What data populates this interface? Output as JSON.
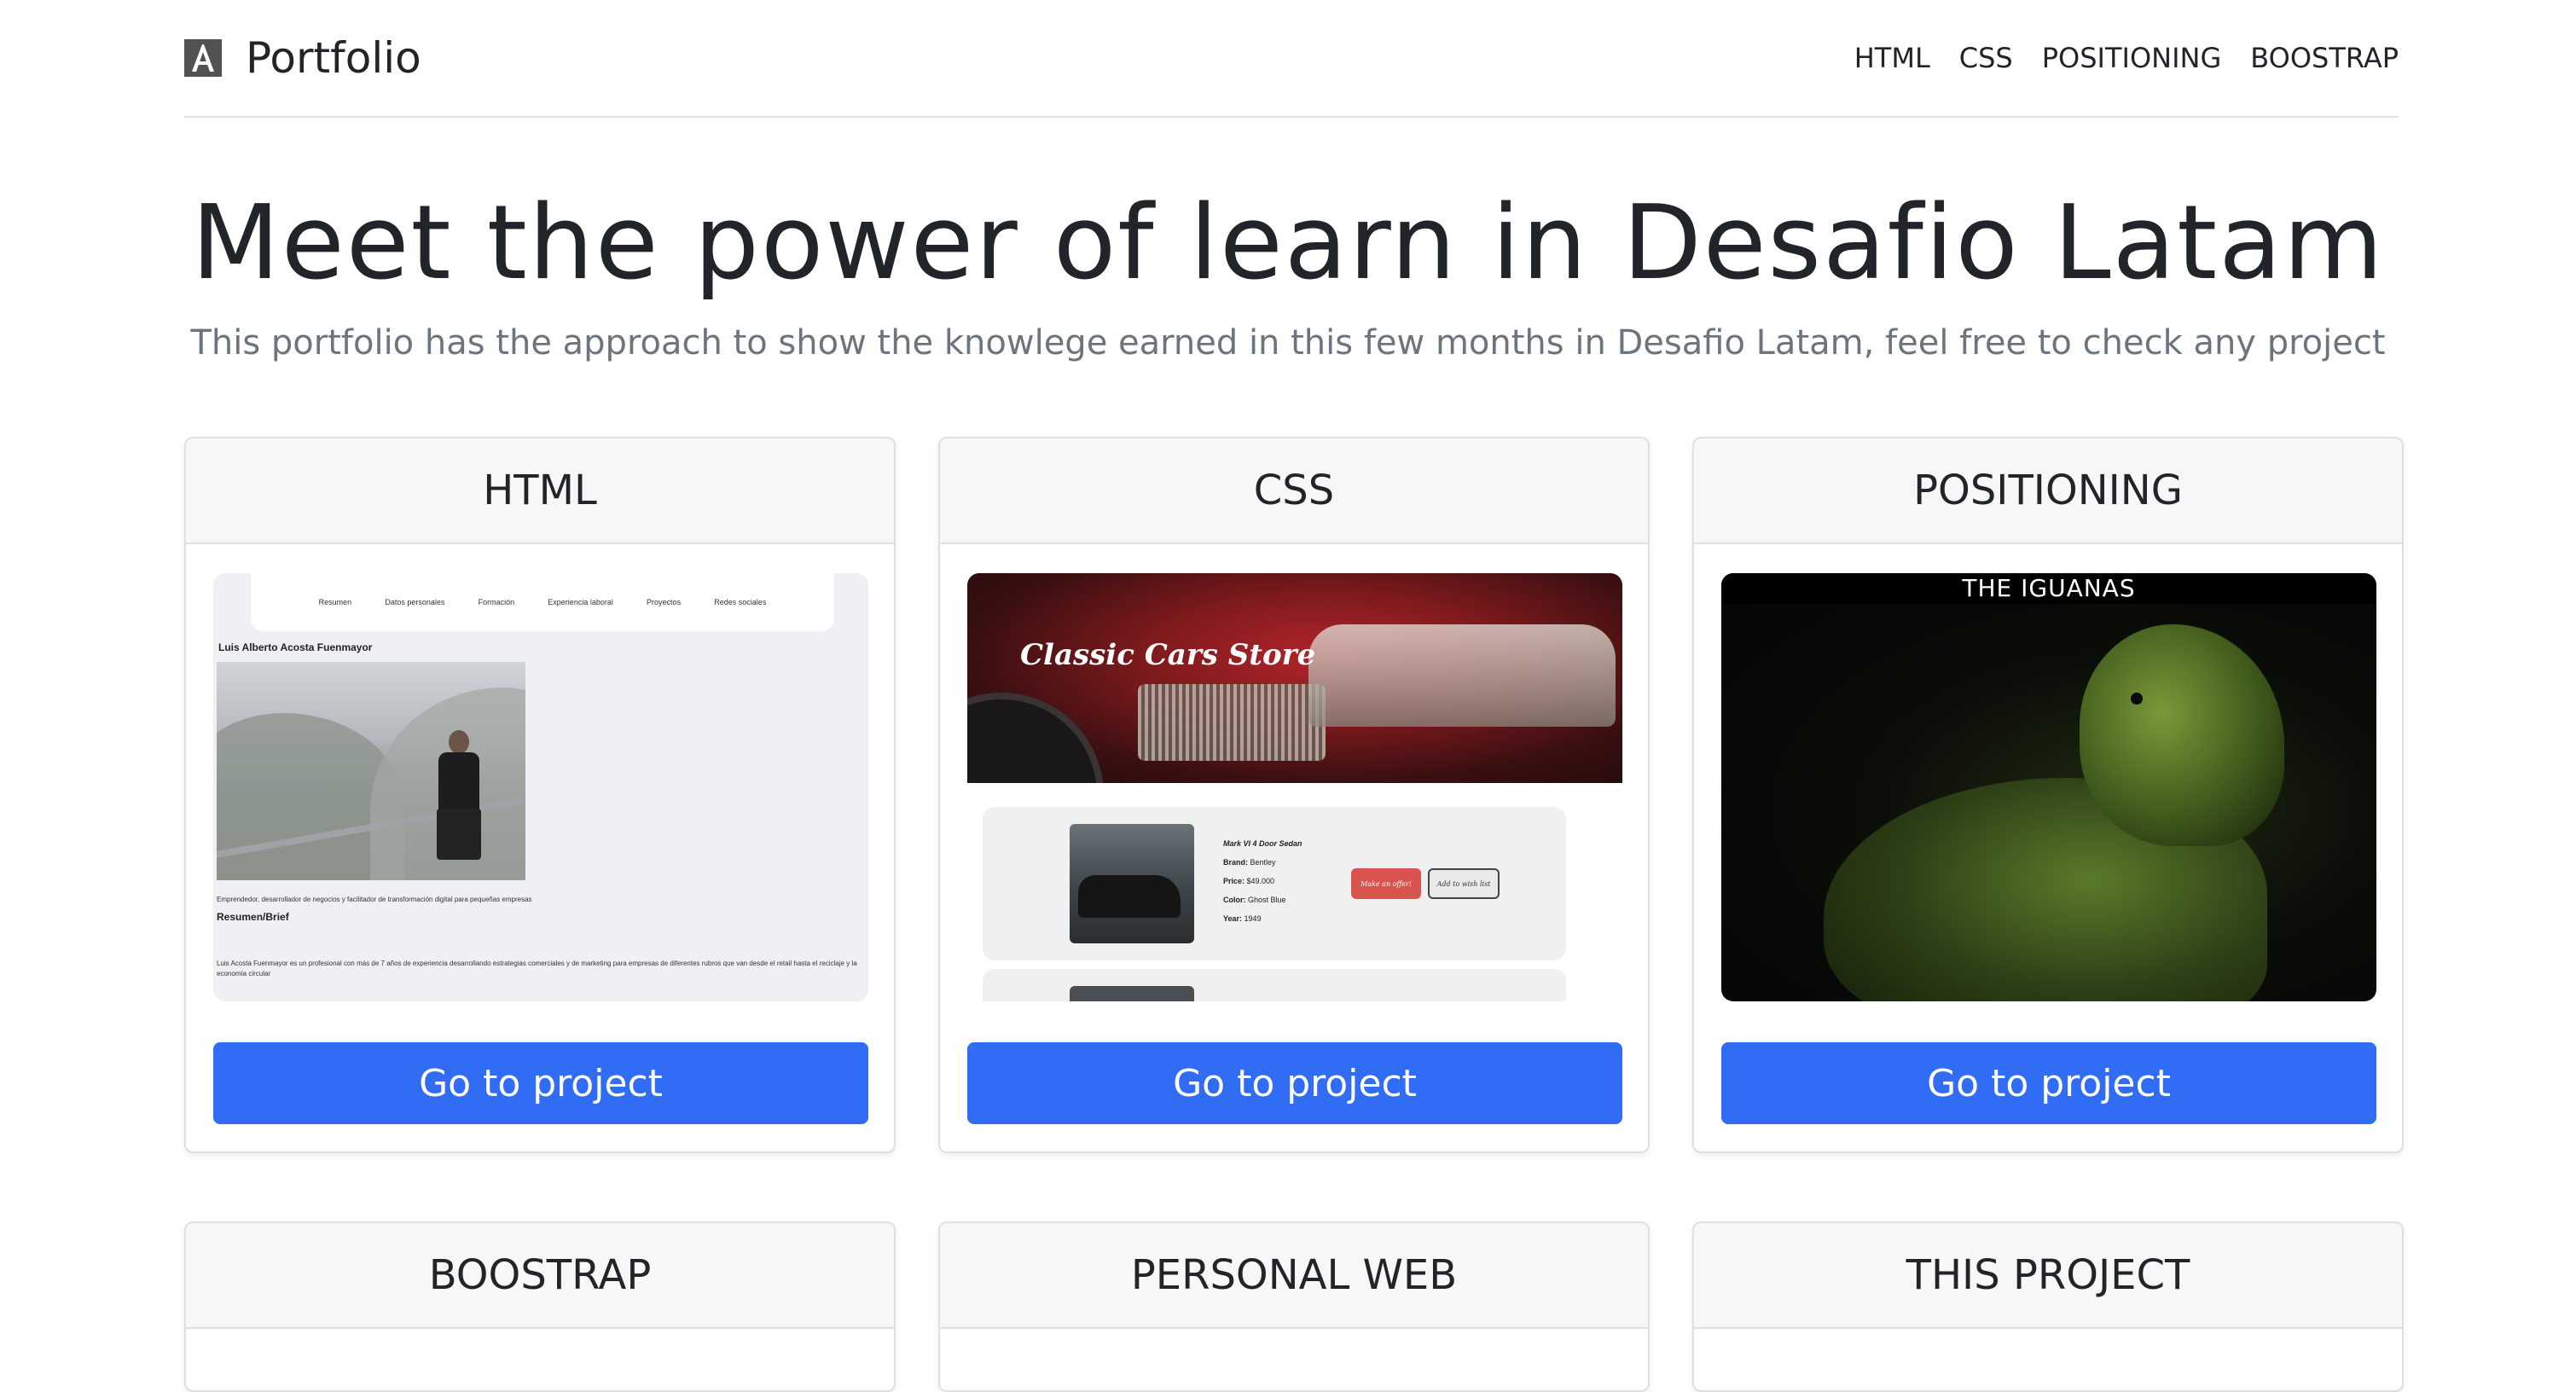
{
  "header": {
    "brand": "Portfolio",
    "nav": [
      "HTML",
      "CSS",
      "POSITIONING",
      "BOOSTRAP"
    ]
  },
  "hero": {
    "title": "Meet the power of learn in Desafio Latam",
    "subtitle": "This portfolio has the approach to show the knowlege earned in this few months in Desafio Latam, feel free to check any project"
  },
  "cards": [
    {
      "title": "HTML",
      "button": "Go to project",
      "preview": {
        "nav": [
          "Resumen",
          "Datos personales",
          "Formación",
          "Experiencia laboral",
          "Proyectos",
          "Redes sociales"
        ],
        "name": "Luis Alberto Acosta Fuenmayor",
        "tagline": "Emprendedor, desarrollador de negocios y facilitador de transformación digital para pequeñas empresas",
        "heading": "Resumen/Brief",
        "paragraph": "Luis Acosta Fuenmayor es un profesional con más de 7 años de experiencia desarrollando estrategias comerciales y de marketing para empresas de diferentes rubros que van desde el retail hasta el reciclaje y la economía circular"
      }
    },
    {
      "title": "CSS",
      "button": "Go to project",
      "preview": {
        "store": "Classic Cars Store",
        "car_name": "Mark VI 4 Door Sedan",
        "brand_label": "Brand:",
        "brand": "Bentley",
        "price_label": "Price:",
        "price": "$49.000",
        "color_label": "Color:",
        "color": "Ghost Blue",
        "year_label": "Year:",
        "year": "1949",
        "offer_button": "Make an offer!",
        "wishlist_button": "Add to wish list"
      }
    },
    {
      "title": "POSITIONING",
      "button": "Go to project",
      "preview": {
        "title": "THE IGUANAS"
      }
    },
    {
      "title": "BOOSTRAP"
    },
    {
      "title": "PERSONAL WEB"
    },
    {
      "title": "THIS PROJECT"
    }
  ],
  "colors": {
    "primary_button": "#316cf4",
    "card_header_bg": "#f7f7f7",
    "subtitle": "#6c757d"
  }
}
